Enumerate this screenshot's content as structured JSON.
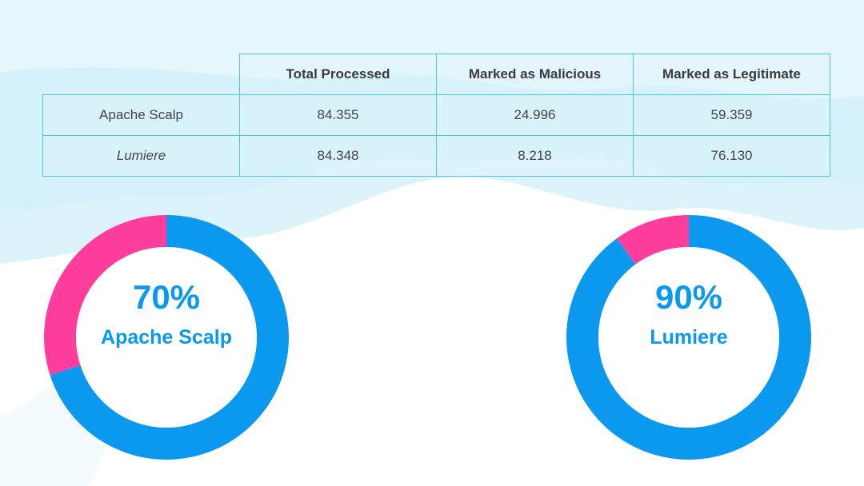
{
  "table": {
    "headers": [
      "",
      "Total Processed",
      "Marked as Malicious",
      "Marked as Legitimate"
    ],
    "rows": [
      {
        "label": "Apache Scalp",
        "values": [
          "84.355",
          "24.996",
          "59.359"
        ]
      },
      {
        "label": "Lumiere",
        "values": [
          "84.348",
          "8.218",
          "76.130"
        ]
      }
    ]
  },
  "colors": {
    "legit": "#0a99ef",
    "malicious": "#ff3d9d",
    "grid": "#4fc3f0",
    "sky": "#dff4fc"
  },
  "chart_data": [
    {
      "type": "pie",
      "title": "Apache Scalp",
      "label": "70%",
      "slices": [
        {
          "value": 70,
          "color": "#0a99ef"
        },
        {
          "value": 30,
          "color": "#ff3d9d"
        }
      ]
    },
    {
      "type": "pie",
      "title": "Lumiere",
      "label": "90%",
      "slices": [
        {
          "value": 90,
          "color": "#0a99ef"
        },
        {
          "value": 10,
          "color": "#ff3d9d"
        }
      ]
    }
  ]
}
